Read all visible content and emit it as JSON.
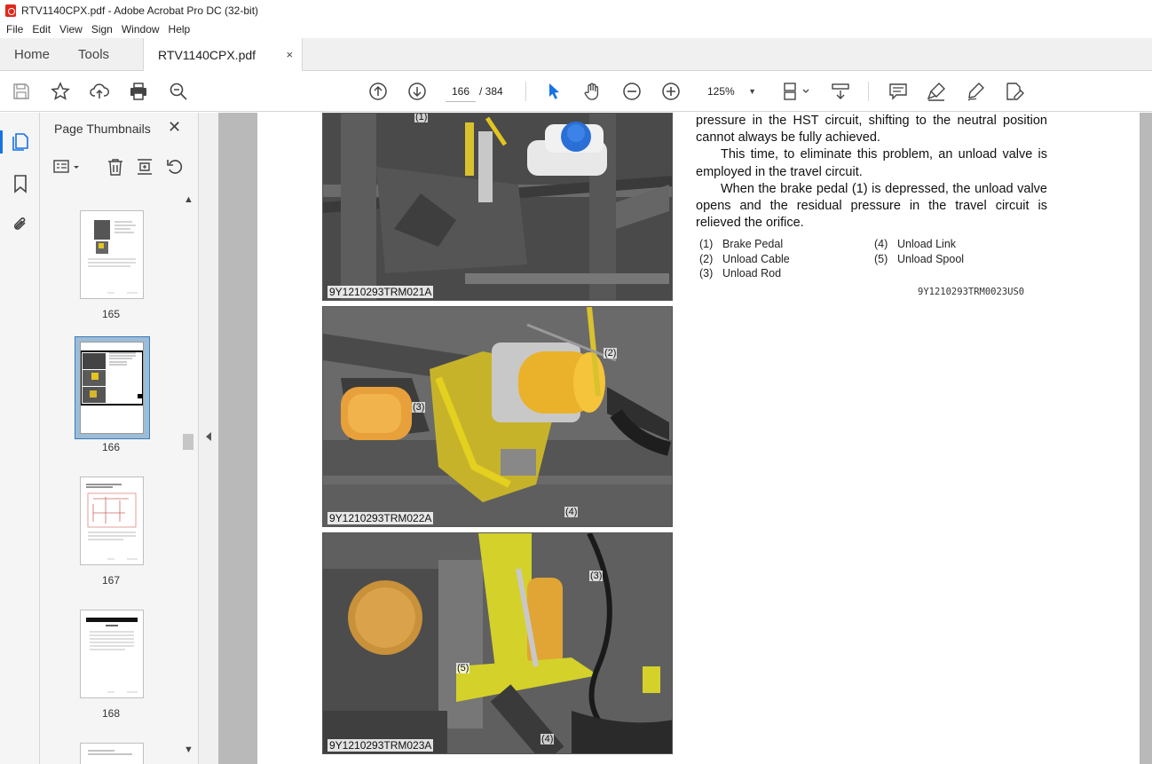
{
  "window": {
    "title": "RTV1140CPX.pdf - Adobe Acrobat Pro DC (32-bit)"
  },
  "menu": [
    "File",
    "Edit",
    "View",
    "Sign",
    "Window",
    "Help"
  ],
  "tabs": {
    "home": "Home",
    "tools": "Tools",
    "document": "RTV1140CPX.pdf",
    "close": "×"
  },
  "toolbar": {
    "current_page": "166",
    "total_pages": "/ 384",
    "zoom": "125%"
  },
  "thumbnails": {
    "title": "Page Thumbnails",
    "close": "✕",
    "pages": [
      "165",
      "166",
      "167",
      "168"
    ],
    "selected": "166"
  },
  "document": {
    "paragraphs": [
      "pressure in the HST circuit, shifting to the neutral position cannot always be fully achieved.",
      "This time, to eliminate this problem, an unload valve is employed in the travel circuit.",
      "When the brake pedal (1) is depressed, the unload valve opens and the residual pressure in the travel circuit is relieved the orifice."
    ],
    "legend": [
      {
        "num": "(1)",
        "label": "Brake Pedal"
      },
      {
        "num": "(2)",
        "label": "Unload Cable"
      },
      {
        "num": "(3)",
        "label": "Unload Rod"
      },
      {
        "num": "(4)",
        "label": "Unload Link"
      },
      {
        "num": "(5)",
        "label": "Unload Spool"
      }
    ],
    "ref_code": "9Y1210293TRM0023US0",
    "figures": [
      {
        "caption": "9Y1210293TRM021A",
        "callouts": [
          "(1)"
        ]
      },
      {
        "caption": "9Y1210293TRM022A",
        "callouts": [
          "(2)",
          "(3)",
          "(4)"
        ]
      },
      {
        "caption": "9Y1210293TRM023A",
        "callouts": [
          "(3)",
          "(5)",
          "(4)"
        ]
      }
    ]
  }
}
